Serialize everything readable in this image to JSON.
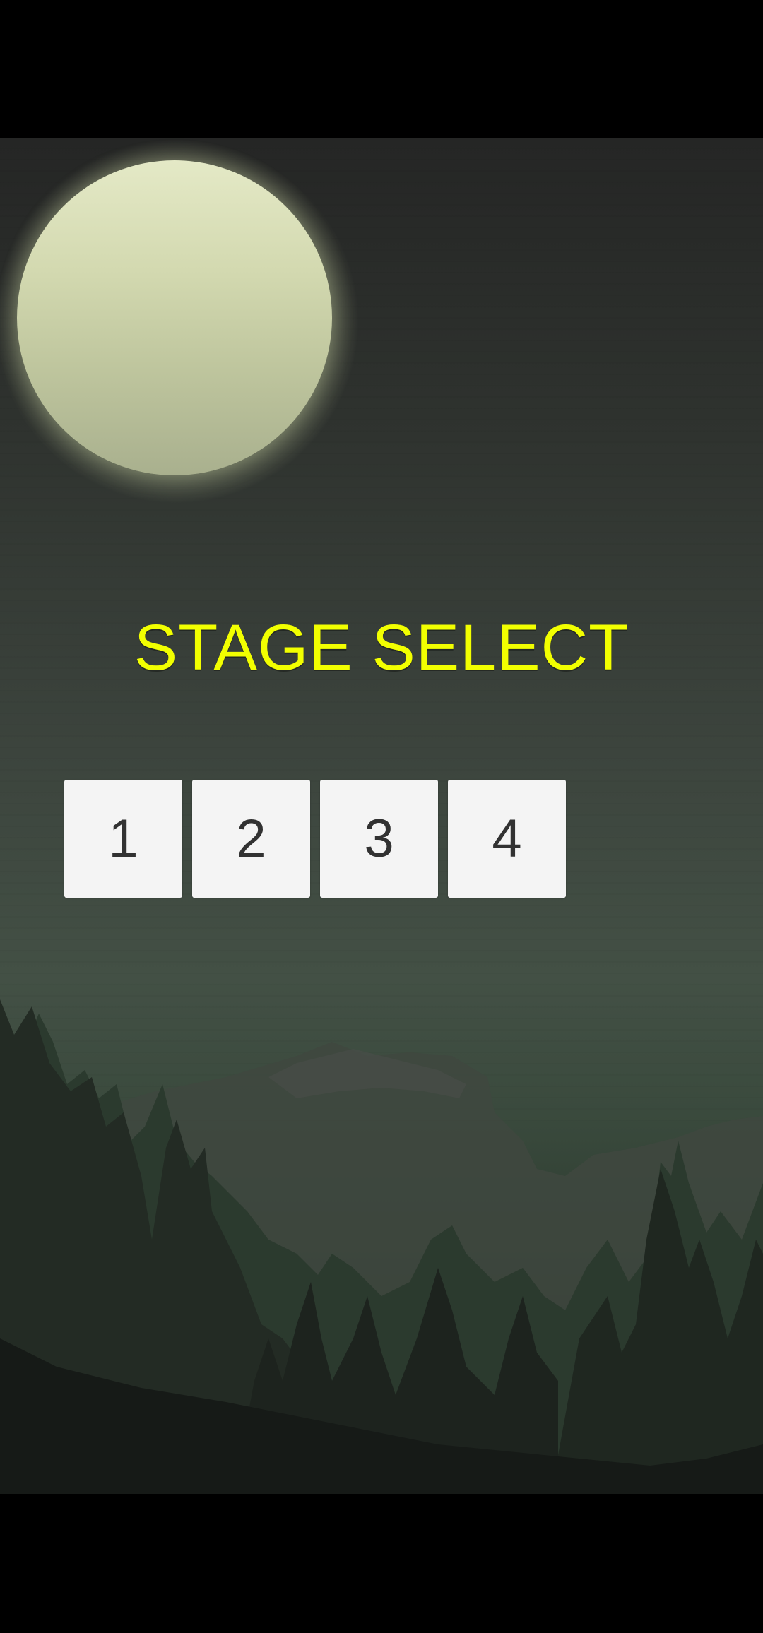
{
  "screen": {
    "title": "STAGE SELECT",
    "title_color": "#f2ff00"
  },
  "stages": [
    {
      "label": "1"
    },
    {
      "label": "2"
    },
    {
      "label": "3"
    },
    {
      "label": "4"
    }
  ],
  "colors": {
    "background_sky": "#2f332f",
    "moon": "#d3d9b0",
    "button_face": "#f4f4f4",
    "button_text": "#323232",
    "letterbox": "#000000"
  }
}
